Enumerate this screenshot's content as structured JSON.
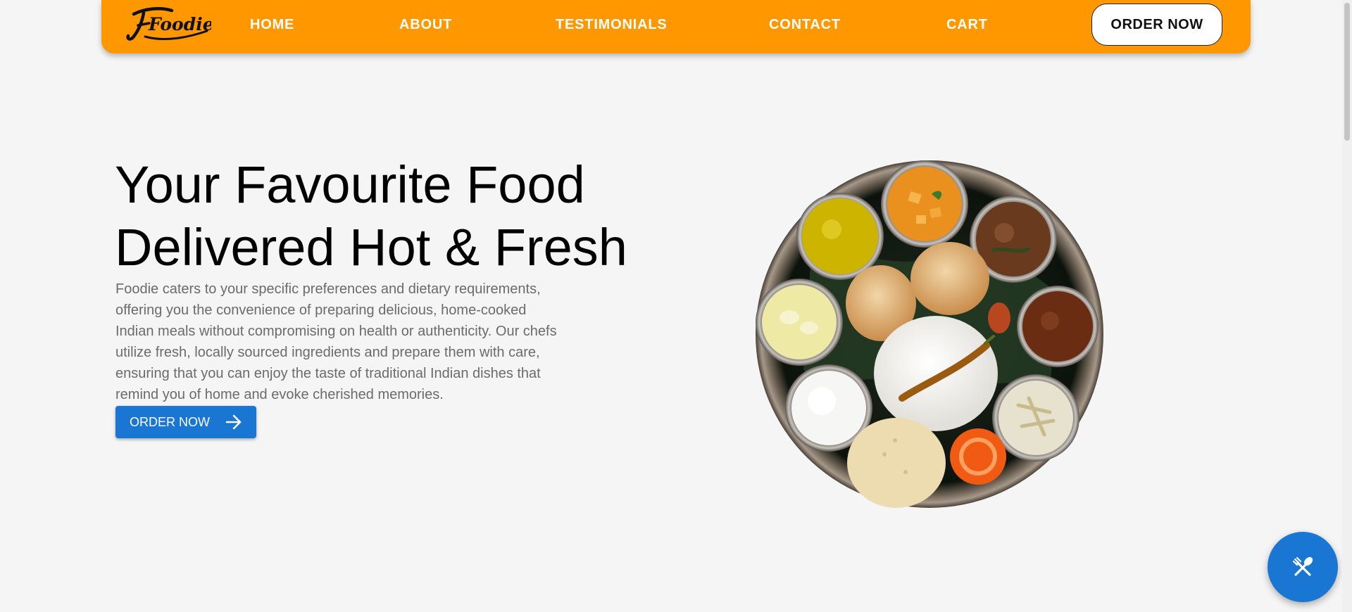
{
  "brand": {
    "logo_text": "Foodie"
  },
  "nav": {
    "links": [
      {
        "label": "HOME"
      },
      {
        "label": "ABOUT"
      },
      {
        "label": "TESTIMONIALS"
      },
      {
        "label": "CONTACT"
      },
      {
        "label": "CART"
      }
    ],
    "cta_label": "ORDER NOW"
  },
  "hero": {
    "title_line1": "Your Favourite Food",
    "title_line2": "Delivered Hot & Fresh",
    "description": "Foodie caters to your specific preferences and dietary requirements, offering you the convenience of preparing delicious, home-cooked Indian meals without compromising on health or authenticity. Our chefs utilize fresh, locally sourced ingredients and prepare them with care, ensuring that you can enjoy the taste of traditional Indian dishes that remind you of home and evoke cherished memories.",
    "button_label": "ORDER NOW",
    "image_alt": "Indian thali plate"
  },
  "fab": {
    "icon": "utensils-crossed-icon"
  },
  "colors": {
    "navbar": "#ff9800",
    "primary": "#1976d2",
    "background": "#f5f5f5",
    "body_text": "#6b6b6b"
  }
}
